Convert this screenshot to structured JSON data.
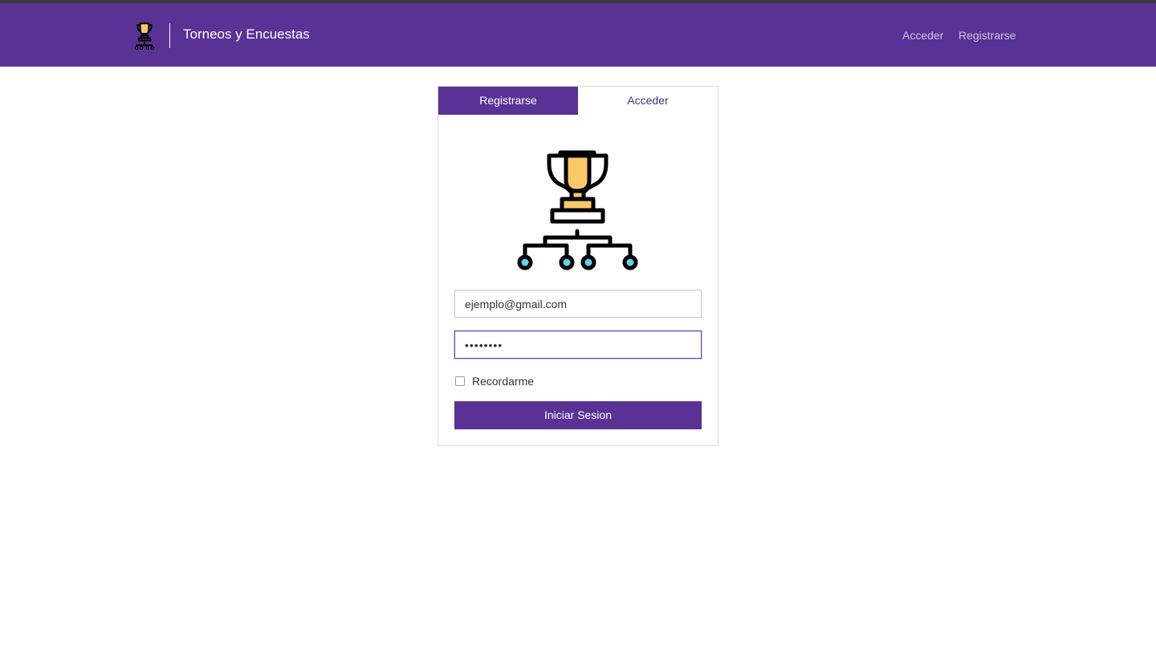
{
  "header": {
    "brand_title": "Torneos y Encuestas",
    "logo_icon": "trophy-bracket-icon",
    "nav_links": [
      "Acceder",
      "Registrarse"
    ]
  },
  "login_card": {
    "tabs": [
      "Registrarse",
      "Acceder"
    ],
    "active_tab": "Registrarse",
    "hero_icon": "trophy-bracket-icon",
    "email": {
      "value": "ejemplo@gmail.com"
    },
    "password": {
      "masked_value": "••••••••"
    },
    "remember_label": "Recordarme",
    "remember_checked": false,
    "submit_label": "Iniciar Sesion"
  },
  "colors": {
    "primary": "#5a3194",
    "nav_link": "#cfc3e6",
    "trophy_gold": "#f9c86a",
    "node_cyan": "#5fd3ea"
  }
}
